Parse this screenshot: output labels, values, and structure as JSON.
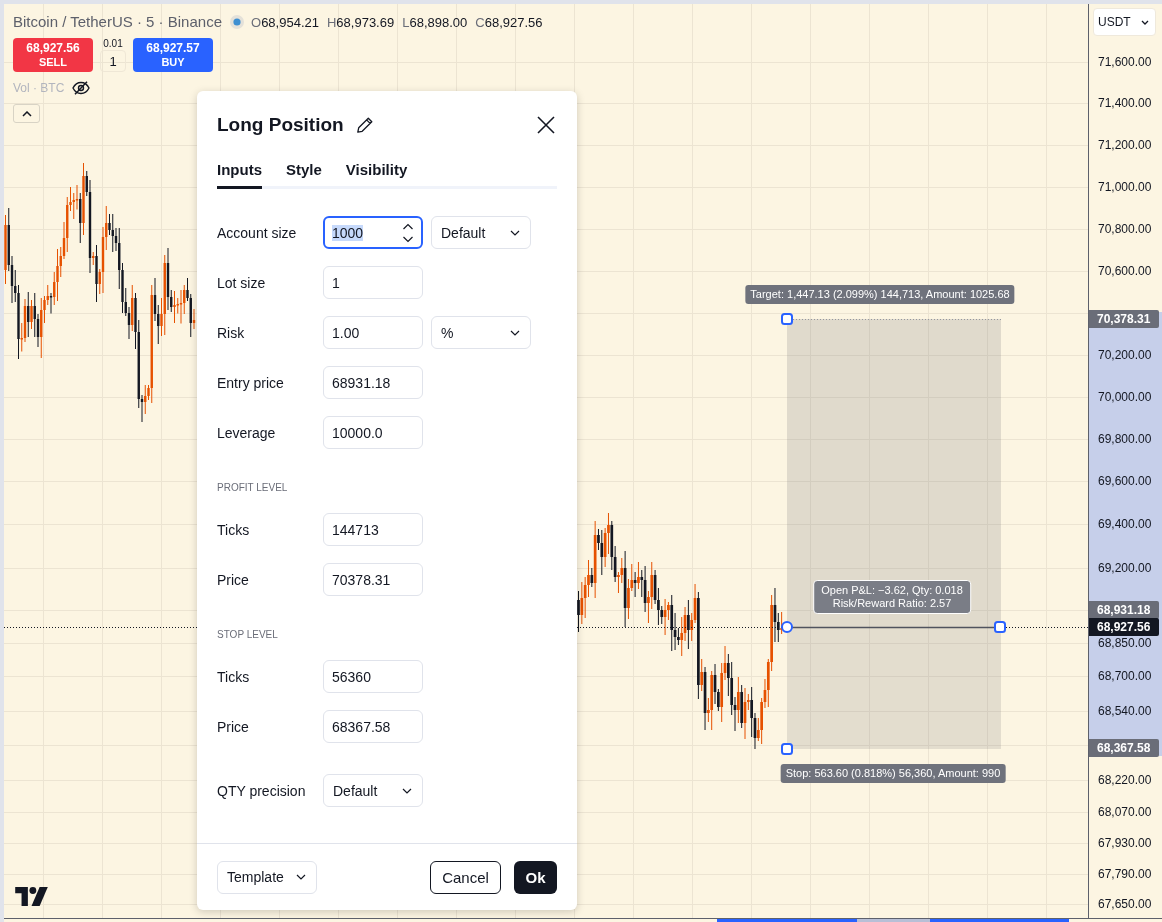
{
  "legend": {
    "title": "Bitcoin / TetherUS · 5 · Binance",
    "ohlc": [
      {
        "label": "O",
        "value": "68,954.21"
      },
      {
        "label": "H",
        "value": "68,973.69"
      },
      {
        "label": "L",
        "value": "68,898.00"
      },
      {
        "label": "C",
        "value": "68,927.56"
      }
    ]
  },
  "trade": {
    "sell": {
      "price": "68,927.56",
      "label": "SELL"
    },
    "spread": "0.01",
    "quantity": "1",
    "buy": {
      "price": "68,927.57",
      "label": "BUY"
    }
  },
  "indicator": {
    "label": "Vol · BTC",
    "visible": false
  },
  "dialog": {
    "title": "Long Position",
    "tabs": [
      {
        "label": "Inputs",
        "selected": true
      },
      {
        "label": "Style",
        "selected": false
      },
      {
        "label": "Visibility",
        "selected": false
      }
    ],
    "rows": [
      {
        "kind": "number",
        "label": "Account size",
        "value": "1000",
        "focused": true,
        "unit": "Default"
      },
      {
        "kind": "number",
        "label": "Lot size",
        "value": "1",
        "focused": false
      },
      {
        "kind": "number",
        "label": "Risk",
        "value": "1.00",
        "focused": false,
        "unit": "%"
      },
      {
        "kind": "number",
        "label": "Entry price",
        "value": "68931.18",
        "focused": false
      },
      {
        "kind": "number",
        "label": "Leverage",
        "value": "10000.0",
        "focused": false
      },
      {
        "kind": "section",
        "label": "PROFIT LEVEL"
      },
      {
        "kind": "number",
        "label": "Ticks",
        "value": "144713",
        "focused": false
      },
      {
        "kind": "number",
        "label": "Price",
        "value": "70378.31",
        "focused": false
      },
      {
        "kind": "section",
        "label": "STOP LEVEL"
      },
      {
        "kind": "number",
        "label": "Ticks",
        "value": "56360",
        "focused": false
      },
      {
        "kind": "number",
        "label": "Price",
        "value": "68367.58",
        "focused": false
      },
      {
        "kind": "select",
        "label": "QTY precision",
        "value": "Default"
      }
    ],
    "template": "Template",
    "buttons": [
      {
        "label": "Cancel",
        "kind": "secondary"
      },
      {
        "label": "Ok",
        "kind": "primary"
      }
    ]
  },
  "position": {
    "target_label": "Target: 1,447.13 (2.099%) 144,713, Amount: 1025.68",
    "stats": [
      "Open P&L: −3.62, Qty: 0.018",
      "Risk/Reward Ratio: 2.57"
    ],
    "stop_label": "Stop: 563.60 (0.818%) 56,360, Amount: 990"
  },
  "price_axis": {
    "currency": "USDT",
    "labels": [
      "71,600.00",
      "71,400.00",
      "71,200.00",
      "71,000.00",
      "70,800.00",
      "70,600.00",
      "70,200.00",
      "70,000.00",
      "69,800.00",
      "69,600.00",
      "69,400.00",
      "69,200.00",
      "68,850.00",
      "68,700.00",
      "68,540.00",
      "68,220.00",
      "68,070.00",
      "67,930.00",
      "67,790.00",
      "67,650.00"
    ],
    "tags": [
      {
        "kind": "target",
        "label": "70,378.31"
      },
      {
        "kind": "entry",
        "label": "68,931.18"
      },
      {
        "kind": "last",
        "label": "68,927.56"
      },
      {
        "kind": "stop",
        "label": "68,367.58"
      }
    ]
  }
}
